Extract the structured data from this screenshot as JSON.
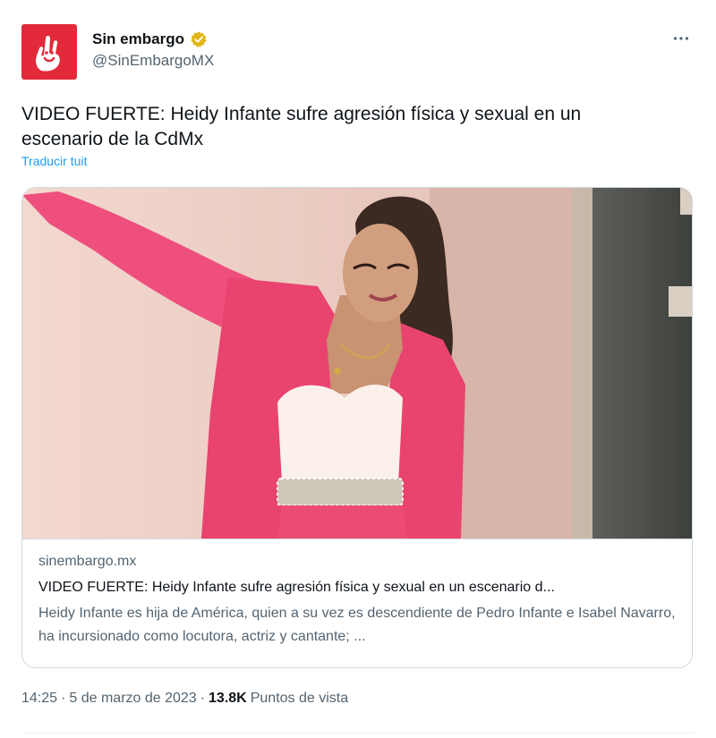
{
  "author": {
    "display_name": "Sin embargo",
    "handle": "@SinEmbargoMX",
    "verified_icon": "gold-verified-badge-icon",
    "avatar_color": "#e32a3a"
  },
  "more_icon": "more-horizontal-icon",
  "tweet": {
    "text": "VIDEO FUERTE: Heidy Infante sufre agresión física y sexual en un escenario de la CdMx",
    "translate_label": "Traducir tuit"
  },
  "card": {
    "image_description_icon": "photo-of-woman-in-pink-suit",
    "domain": "sinembargo.mx",
    "title": "VIDEO FUERTE: Heidy Infante sufre agresión física y sexual en un escenario d...",
    "description": "Heidy Infante es hija de América, quien a su vez es descendiente de Pedro Infante e Isabel Navarro, ha incursionado como locutora, actriz y cantante; ..."
  },
  "footer": {
    "time": "14:25",
    "separator": "·",
    "date": "5 de marzo de 2023",
    "views_count": "13.8K",
    "views_label": "Puntos de vista"
  },
  "colors": {
    "accent_link": "#1d9bf0",
    "secondary_text": "#536471",
    "primary_text": "#0f1419",
    "border": "#cfd9de",
    "verified_gold": "#e2b719"
  }
}
